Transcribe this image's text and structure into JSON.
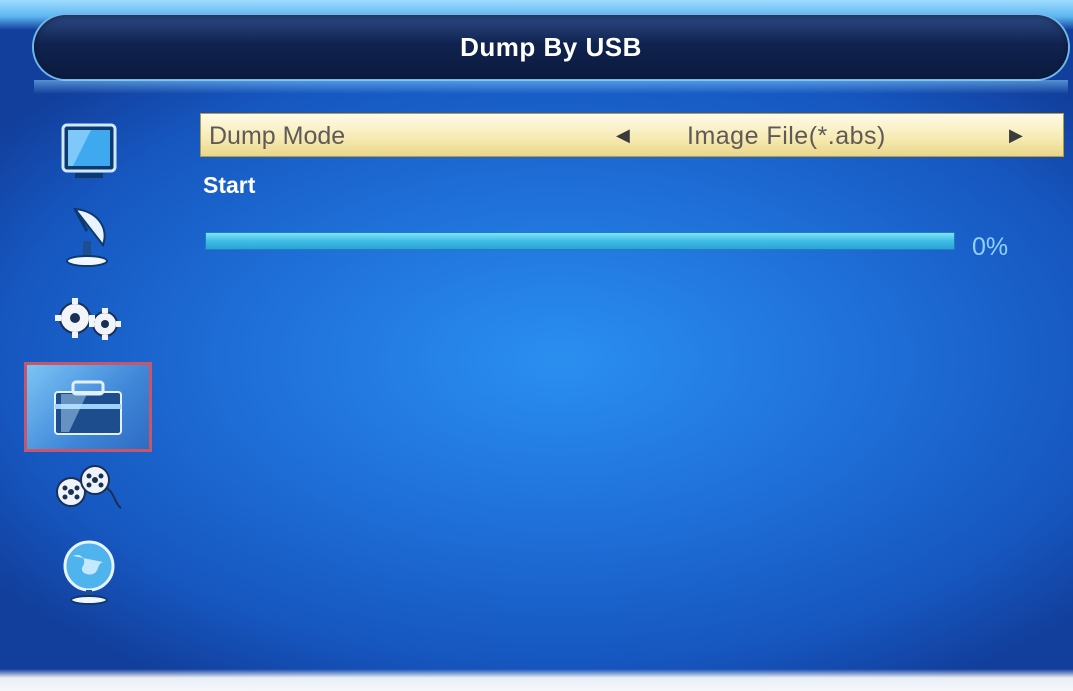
{
  "window": {
    "title": "Dump By USB"
  },
  "sidebar": {
    "items": [
      {
        "icon": "tv-screen-icon",
        "selected": false
      },
      {
        "icon": "satellite-dish-icon",
        "selected": false
      },
      {
        "icon": "gears-icon",
        "selected": false
      },
      {
        "icon": "toolbox-icon",
        "selected": true
      },
      {
        "icon": "film-reels-icon",
        "selected": false
      },
      {
        "icon": "globe-icon",
        "selected": false
      }
    ]
  },
  "main": {
    "dump_mode": {
      "label": "Dump Mode",
      "value": "Image File(*.abs)",
      "left_arrow": "◀",
      "right_arrow": "▶"
    },
    "start_label": "Start",
    "progress": {
      "value_fraction": 0,
      "text": "0%"
    }
  },
  "colors": {
    "background": "#1f6fd8",
    "title_bar": "#10234f",
    "highlight_row": "#f6eab0",
    "selected_border": "#c8566a",
    "progress_track": "#3fbde6",
    "progress_text": "#8fd2ff"
  }
}
